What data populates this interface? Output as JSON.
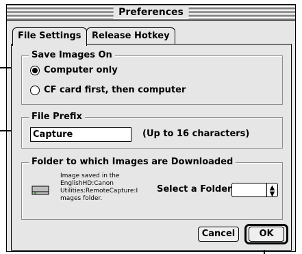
{
  "window": {
    "title": "Preferences"
  },
  "tabs": [
    {
      "label": "File Settings",
      "active": true
    },
    {
      "label": "Release Hotkey",
      "active": false
    }
  ],
  "save_images": {
    "legend": "Save Images On",
    "options": [
      {
        "label": "Computer only",
        "selected": true
      },
      {
        "label": "CF card first, then computer",
        "selected": false
      }
    ]
  },
  "file_prefix": {
    "legend": "File Prefix",
    "value": "Capture",
    "hint": "(Up to 16 characters)"
  },
  "folder": {
    "legend": "Folder to which Images are Downloaded",
    "info": [
      "Image saved in the",
      "EnglishHD:Canon",
      "Utilities:RemoteCapture:I",
      "mages folder."
    ],
    "select_label": "Select a Folder:",
    "select_value": "",
    "icon": "hard-drive-icon"
  },
  "buttons": {
    "cancel": "Cancel",
    "ok": "OK"
  }
}
